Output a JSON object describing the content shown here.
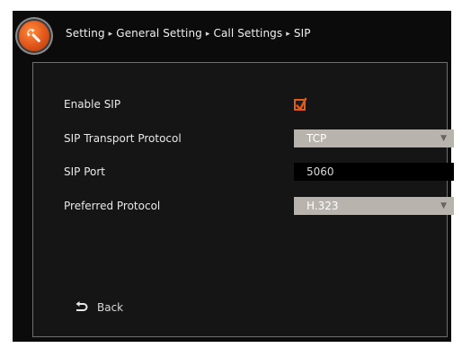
{
  "breadcrumb": {
    "items": [
      "Setting",
      "General Setting",
      "Call Settings",
      "SIP"
    ],
    "separator": "▸"
  },
  "settings": {
    "enable_sip": {
      "label": "Enable SIP",
      "checked": true
    },
    "transport": {
      "label": "SIP Transport Protocol",
      "value": "TCP"
    },
    "port": {
      "label": "SIP Port",
      "value": "5060"
    },
    "preferred": {
      "label": "Preferred Protocol",
      "value": "H.323"
    }
  },
  "back": {
    "label": "Back"
  },
  "colors": {
    "accent": "#e05a1a",
    "background": "#0b0b0b",
    "select_bg": "#b9b3ad"
  },
  "icons": {
    "logo": "wrench-icon",
    "back": "back-arrow-icon",
    "dropdown": "dropdown-arrow-icon",
    "check": "checkmark-icon"
  }
}
